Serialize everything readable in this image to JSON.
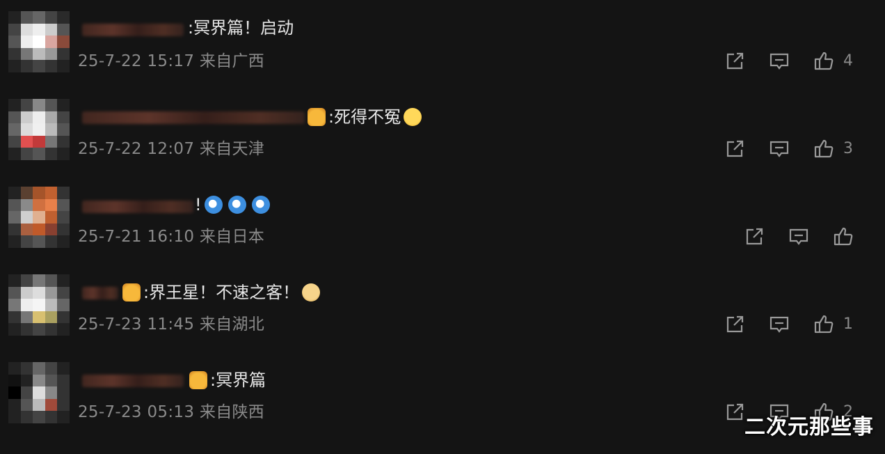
{
  "comments": [
    {
      "text": ":冥界篇！启动",
      "emojis": [],
      "time": "25-7-22 15:17",
      "location": "来自广西",
      "likes": "4",
      "avatar_colors": [
        "#222",
        "#555",
        "#666",
        "#444",
        "#2a2a2a",
        "#444",
        "#ddd",
        "#eee",
        "#ccc",
        "#555",
        "#555",
        "#eee",
        "#fff",
        "#d9a6a0",
        "#8a4a3a",
        "#333",
        "#777",
        "#bbb",
        "#999",
        "#333",
        "#222",
        "#333",
        "#444",
        "#333",
        "#222"
      ]
    },
    {
      "text": ":死得不冤",
      "emojis_before": [
        "crown-emoji"
      ],
      "emojis_after": [
        "laugh-cry-emoji"
      ],
      "time": "25-7-22 12:07",
      "location": "来自天津",
      "likes": "3",
      "avatar_colors": [
        "#222",
        "#444",
        "#888",
        "#555",
        "#222",
        "#555",
        "#ccc",
        "#eee",
        "#aaa",
        "#444",
        "#666",
        "#ddd",
        "#f0f0f0",
        "#bbb",
        "#555",
        "#444",
        "#e25050",
        "#c23a3a",
        "#777",
        "#333",
        "#222",
        "#444",
        "#555",
        "#333",
        "#222"
      ]
    },
    {
      "text": "!",
      "emojis_after": [
        "shark-emoji",
        "shark-emoji",
        "shark-emoji"
      ],
      "time": "25-7-21 16:10",
      "location": "来自日本",
      "likes": "",
      "avatar_colors": [
        "#222",
        "#5a4030",
        "#a5542a",
        "#c26130",
        "#333",
        "#555",
        "#8a8a8a",
        "#d07040",
        "#e8804a",
        "#555",
        "#666",
        "#cfcfcf",
        "#e0b090",
        "#c06030",
        "#444",
        "#333",
        "#aa6040",
        "#c05a2a",
        "#884030",
        "#333",
        "#222",
        "#444",
        "#555",
        "#333",
        "#222"
      ]
    },
    {
      "text": ":界王星！不速之客！",
      "emojis_before": [
        "crown-emoji"
      ],
      "emojis_after": [
        "doge-emoji"
      ],
      "time": "25-7-23 11:45",
      "location": "来自湖北",
      "likes": "1",
      "avatar_colors": [
        "#222",
        "#444",
        "#777",
        "#555",
        "#222",
        "#555",
        "#ccc",
        "#ddd",
        "#999",
        "#444",
        "#777",
        "#eee",
        "#f5f5f5",
        "#bbb",
        "#666",
        "#333",
        "#777",
        "#d8c070",
        "#aaa060",
        "#333",
        "#222",
        "#333",
        "#444",
        "#333",
        "#222"
      ]
    },
    {
      "text": ":冥界篇",
      "emojis_before": [
        "crown-emoji"
      ],
      "time": "25-7-23 05:13",
      "location": "来自陕西",
      "likes": "2",
      "avatar_colors": [
        "#222",
        "#333",
        "#666",
        "#444",
        "#222",
        "#111",
        "#222",
        "#888",
        "#555",
        "#333",
        "#000",
        "#444",
        "#ddd",
        "#888",
        "#333",
        "#222",
        "#555",
        "#bbb",
        "#a04a3a",
        "#333",
        "#222",
        "#333",
        "#444",
        "#333",
        "#222"
      ]
    }
  ],
  "watermark": "二次元那些事"
}
